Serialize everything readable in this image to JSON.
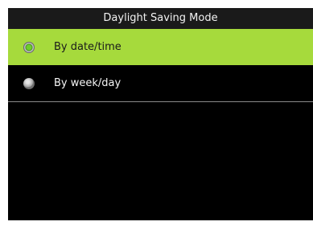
{
  "header": {
    "title": "Daylight Saving Mode"
  },
  "options": [
    {
      "label": "By date/time",
      "selected": true
    },
    {
      "label": "By week/day",
      "selected": false
    }
  ],
  "colors": {
    "background": "#000000",
    "title_bar": "#1a1a1a",
    "selected_row": "#a6da3c",
    "divider": "#8a8a8a",
    "selected_radio": "#6fcf2a"
  }
}
